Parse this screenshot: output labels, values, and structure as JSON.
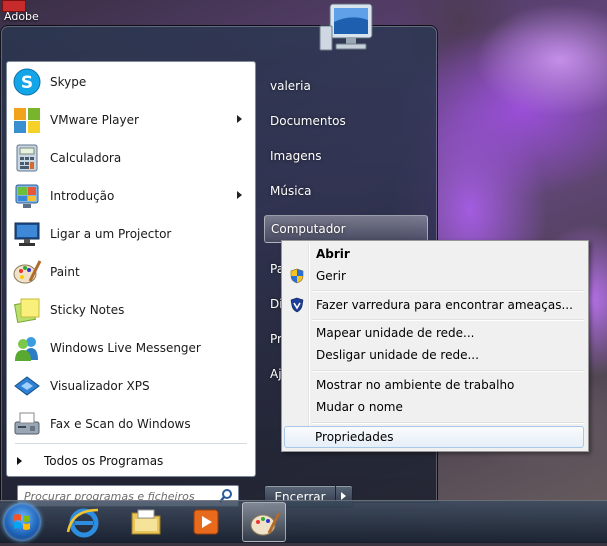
{
  "desktop": {
    "shortcut_label": "Adobe"
  },
  "start_menu": {
    "pinned_programs": [
      {
        "label": "Skype",
        "icon": "skype-icon",
        "has_submenu": false
      },
      {
        "label": "VMware Player",
        "icon": "vmware-player-icon",
        "has_submenu": true
      },
      {
        "label": "Calculadora",
        "icon": "calculator-icon",
        "has_submenu": false
      },
      {
        "label": "Introdução",
        "icon": "getting-started-icon",
        "has_submenu": true
      },
      {
        "label": "Ligar a um Projector",
        "icon": "projector-icon",
        "has_submenu": false
      },
      {
        "label": "Paint",
        "icon": "paint-icon",
        "has_submenu": false
      },
      {
        "label": "Sticky Notes",
        "icon": "sticky-notes-icon",
        "has_submenu": false
      },
      {
        "label": "Windows Live Messenger",
        "icon": "messenger-icon",
        "has_submenu": false
      },
      {
        "label": "Visualizador XPS",
        "icon": "xps-viewer-icon",
        "has_submenu": false
      },
      {
        "label": "Fax e Scan do Windows",
        "icon": "fax-scan-icon",
        "has_submenu": false
      }
    ],
    "all_programs_label": "Todos os Programas",
    "search_placeholder": "Procurar programas e ficheiros",
    "right_items": {
      "user": "valeria",
      "documents": "Documentos",
      "pictures": "Imagens",
      "music": "Música",
      "computer": "Computador",
      "partial_1": "Pa",
      "partial_2": "Di",
      "partial_3": "Pr",
      "partial_4": "Aj"
    },
    "shutdown_label": "Encerrar"
  },
  "context_menu": {
    "open": "Abrir",
    "manage": "Gerir",
    "scan": "Fazer varredura para encontrar ameaças...",
    "map_drive": "Mapear unidade de rede...",
    "disconnect_drive": "Desligar unidade de rede...",
    "show_on_desktop": "Mostrar no ambiente de trabalho",
    "rename": "Mudar o nome",
    "properties": "Propriedades"
  },
  "taskbar": {
    "buttons": [
      "start-orb",
      "internet-explorer-icon",
      "windows-explorer-icon",
      "media-player-icon",
      "paint-icon"
    ]
  }
}
